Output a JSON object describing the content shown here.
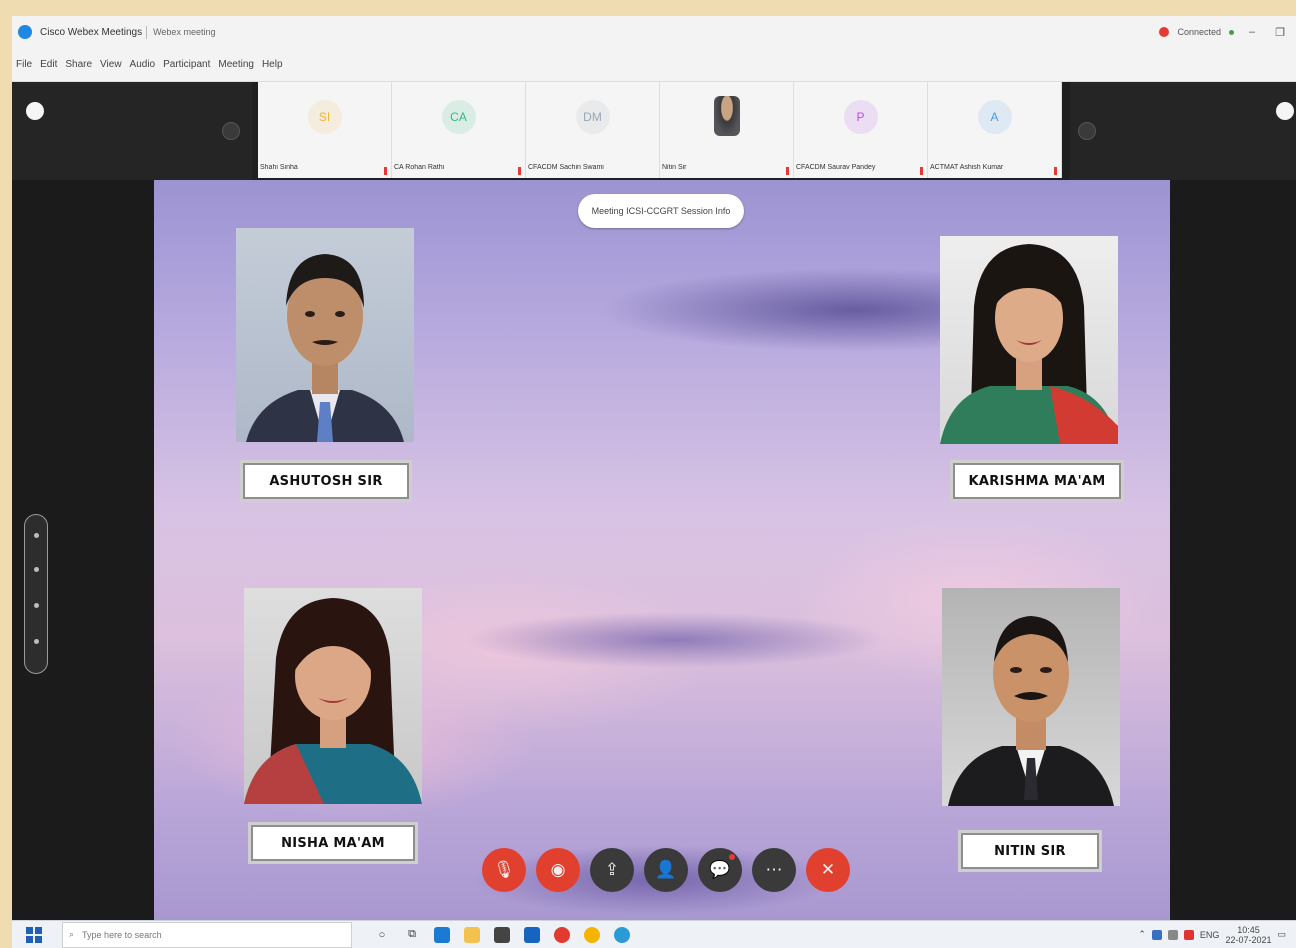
{
  "window": {
    "app_title": "Cisco Webex Meetings",
    "meeting_name": "Webex meeting",
    "status_text": "Connected",
    "minimize": "–",
    "restore": "❐"
  },
  "menubar": {
    "items": [
      "File",
      "Edit",
      "Share",
      "View",
      "Audio",
      "Participant",
      "Meeting",
      "Help"
    ]
  },
  "participants_strip": [
    {
      "initials": "SI",
      "name": "Shahi Sinha",
      "color": "#f0b43c"
    },
    {
      "initials": "CA",
      "name": "CA Rohan Rathi",
      "color": "#2ebd83"
    },
    {
      "initials": "DM",
      "name": "CFACDM Sachin Swami",
      "color": "#9aa7b3"
    },
    {
      "initials": "",
      "name": "Nitin Sir",
      "color": ""
    },
    {
      "initials": "P",
      "name": "CFACDM Saurav Pandey",
      "color": "#b44ee0"
    },
    {
      "initials": "A",
      "name": "ACTMAT Ashish Kumar",
      "color": "#4a9be8"
    }
  ],
  "stage": {
    "meeting_pill": "Meeting ICSI-CCGRT Session Info"
  },
  "speakers": {
    "top_left": "ASHUTOSH SIR",
    "top_right": "KARISHMA MA'AM",
    "bottom_left": "NISHA MA'AM",
    "bottom_right": "NITIN SIR"
  },
  "controls": [
    {
      "name": "mute-button",
      "icon": "🎙",
      "style": "red"
    },
    {
      "name": "stop-video-button",
      "icon": "◉",
      "style": "red"
    },
    {
      "name": "share-button",
      "icon": "⇪",
      "style": "dark"
    },
    {
      "name": "participants-button",
      "icon": "👤",
      "style": "dark"
    },
    {
      "name": "chat-button",
      "icon": "💬",
      "style": "dark"
    },
    {
      "name": "more-button",
      "icon": "⋯",
      "style": "dark"
    },
    {
      "name": "leave-button",
      "icon": "✕",
      "style": "red"
    }
  ],
  "taskbar": {
    "search_placeholder": "Type here to search",
    "language": "ENG",
    "time": "10:45",
    "date": "22-07-2021"
  }
}
